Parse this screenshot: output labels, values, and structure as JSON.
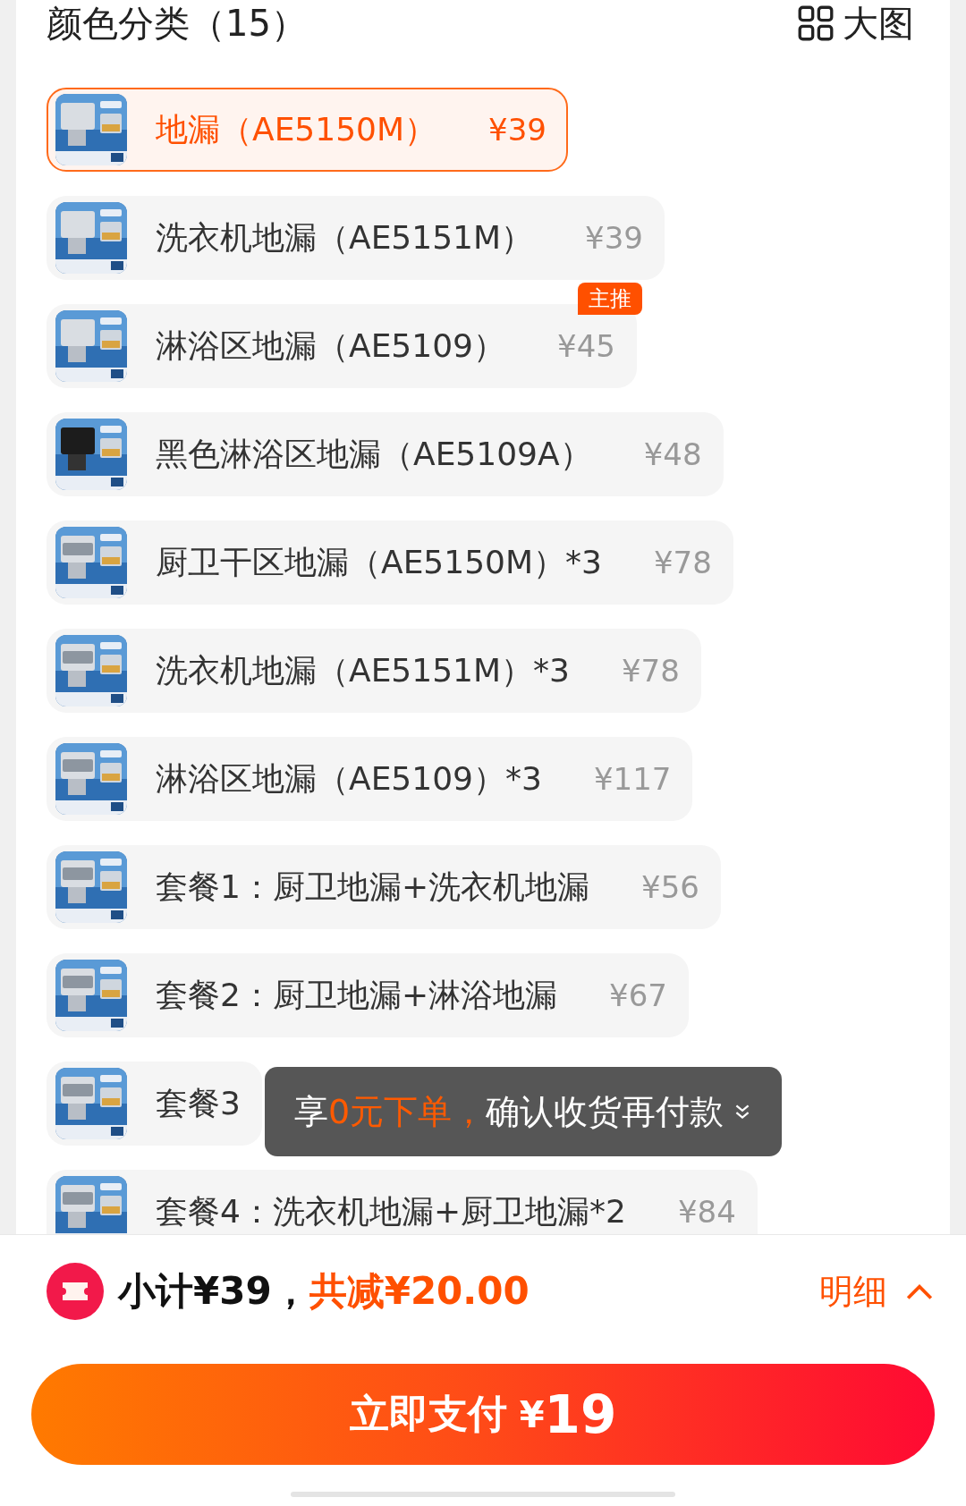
{
  "header": {
    "title": "颜色分类（15）",
    "view_toggle": "大图"
  },
  "options": [
    {
      "label": "地漏（AE5150M）",
      "price": "¥39",
      "selected": true
    },
    {
      "label": "洗衣机地漏（AE5151M）",
      "price": "¥39",
      "selected": false
    },
    {
      "label": "淋浴区地漏（AE5109）",
      "price": "¥45",
      "selected": false,
      "badge": "主推"
    },
    {
      "label": "黑色淋浴区地漏（AE5109A）",
      "price": "¥48",
      "selected": false
    },
    {
      "label": "厨卫干区地漏（AE5150M）*3",
      "price": "¥78",
      "selected": false
    },
    {
      "label": "洗衣机地漏（AE5151M）*3",
      "price": "¥78",
      "selected": false
    },
    {
      "label": "淋浴区地漏（AE5109）*3",
      "price": "¥117",
      "selected": false
    },
    {
      "label": "套餐1：厨卫地漏+洗衣机地漏",
      "price": "¥56",
      "selected": false
    },
    {
      "label": "套餐2：厨卫地漏+淋浴地漏",
      "price": "¥67",
      "selected": false
    },
    {
      "label": "套餐3",
      "selected": false
    },
    {
      "label": "套餐4：洗衣机地漏+厨卫地漏*2",
      "price": "¥84",
      "selected": false
    }
  ],
  "toast": {
    "parts": [
      {
        "text": "享",
        "highlight": false
      },
      {
        "text": "0元下单，",
        "highlight": true
      },
      {
        "text": "确认收货再付款",
        "highlight": false
      }
    ]
  },
  "summary": {
    "subtotal": "小计¥39，",
    "discount": "共减¥20.00",
    "details": "明细"
  },
  "pay_button": {
    "label": "立即支付",
    "currency": "¥",
    "amount": "19"
  }
}
